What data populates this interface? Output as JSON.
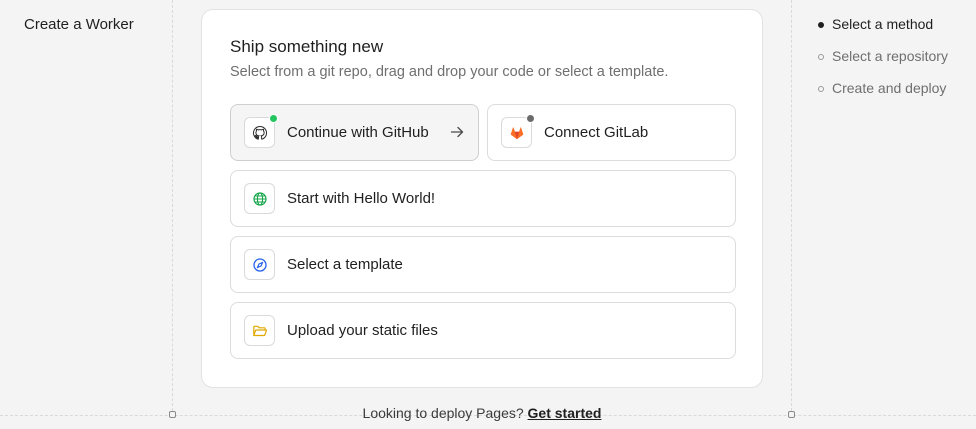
{
  "left_title": "Create a Worker",
  "card": {
    "title": "Ship something new",
    "subtitle": "Select from a git repo, drag and drop your code or select a template."
  },
  "options": {
    "github": {
      "label": "Continue with GitHub",
      "icon": "github-icon",
      "status_color": "#22c55e"
    },
    "gitlab": {
      "label": "Connect GitLab",
      "icon": "gitlab-icon",
      "status_color": "#6b6b6b"
    },
    "hello_world": {
      "label": "Start with Hello World!",
      "icon": "globe-icon",
      "icon_color": "#16a34a"
    },
    "template": {
      "label": "Select a template",
      "icon": "compass-icon",
      "icon_color": "#2563eb"
    },
    "upload": {
      "label": "Upload your static files",
      "icon": "folder-open-icon",
      "icon_color": "#e0a800"
    }
  },
  "steps": [
    {
      "label": "Select a method",
      "active": true
    },
    {
      "label": "Select a repository",
      "active": false
    },
    {
      "label": "Create and deploy",
      "active": false
    }
  ],
  "footer": {
    "text": "Looking to deploy Pages?",
    "link": "Get started"
  },
  "colors": {
    "active_step": "#1f1f1f",
    "inactive_step": "#6f6f6f"
  }
}
